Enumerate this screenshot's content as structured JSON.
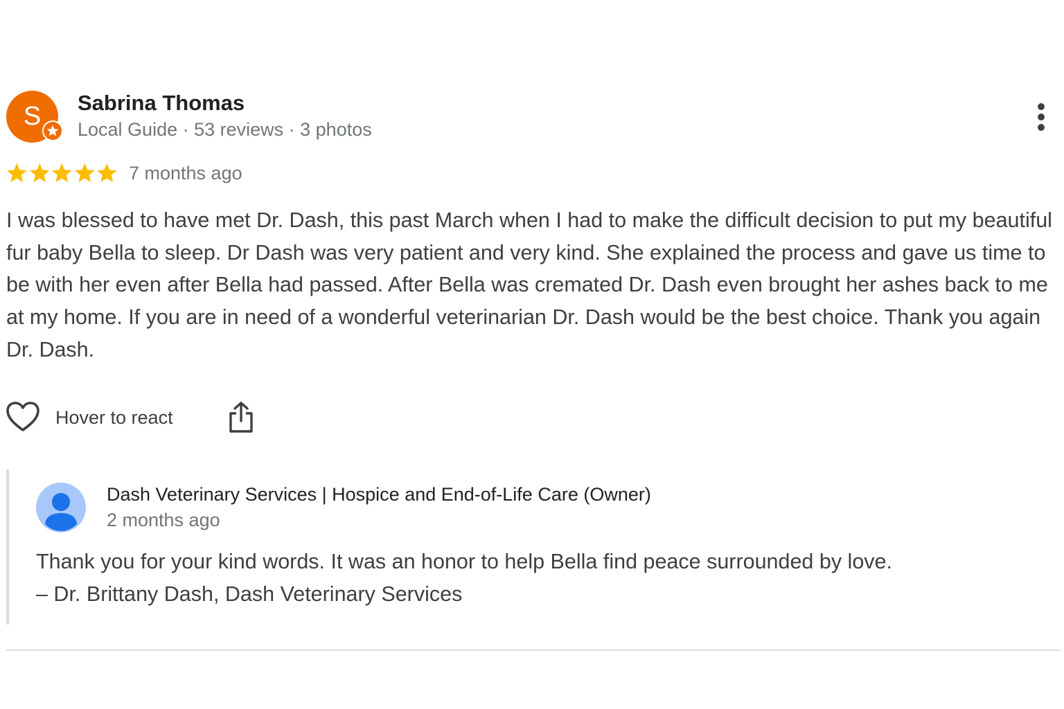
{
  "review": {
    "avatar_letter": "S",
    "avatar_color": "#ef6c00",
    "reviewer_name": "Sabrina Thomas",
    "reviewer_meta": "Local Guide · 53 reviews · 3 photos",
    "rating": 5,
    "rating_max": 5,
    "star_color": "#fbbc04",
    "time": "7 months ago",
    "body": "I was blessed to have met Dr. Dash, this past March when I had to make the difficult decision to put my beautiful fur baby Bella to sleep. Dr Dash was very patient and very kind. She explained the process and gave us time to be with her even after Bella had passed. After Bella was cremated Dr. Dash even brought her ashes back to me at my home. If you are in need of a wonderful veterinarian Dr. Dash would be the best choice. Thank you again Dr. Dash.",
    "icons": {
      "more": "more-vert-icon",
      "badge": "local-guide-star-icon",
      "react": "heart-outline-icon",
      "share": "share-icon"
    }
  },
  "actions": {
    "react_label": "Hover to react"
  },
  "owner_response": {
    "name": "Dash Veterinary Services | Hospice and End-of-Life Care (Owner)",
    "time": "2 months ago",
    "line1": "Thank you for your kind words. It was an honor to help Bella find peace surrounded by love.",
    "line2": "– Dr. Brittany Dash, Dash Veterinary Services",
    "avatar_icon": "default-person-avatar-icon",
    "avatar_colors": {
      "background": "#a8c7fa",
      "figure": "#1a73e8"
    }
  }
}
